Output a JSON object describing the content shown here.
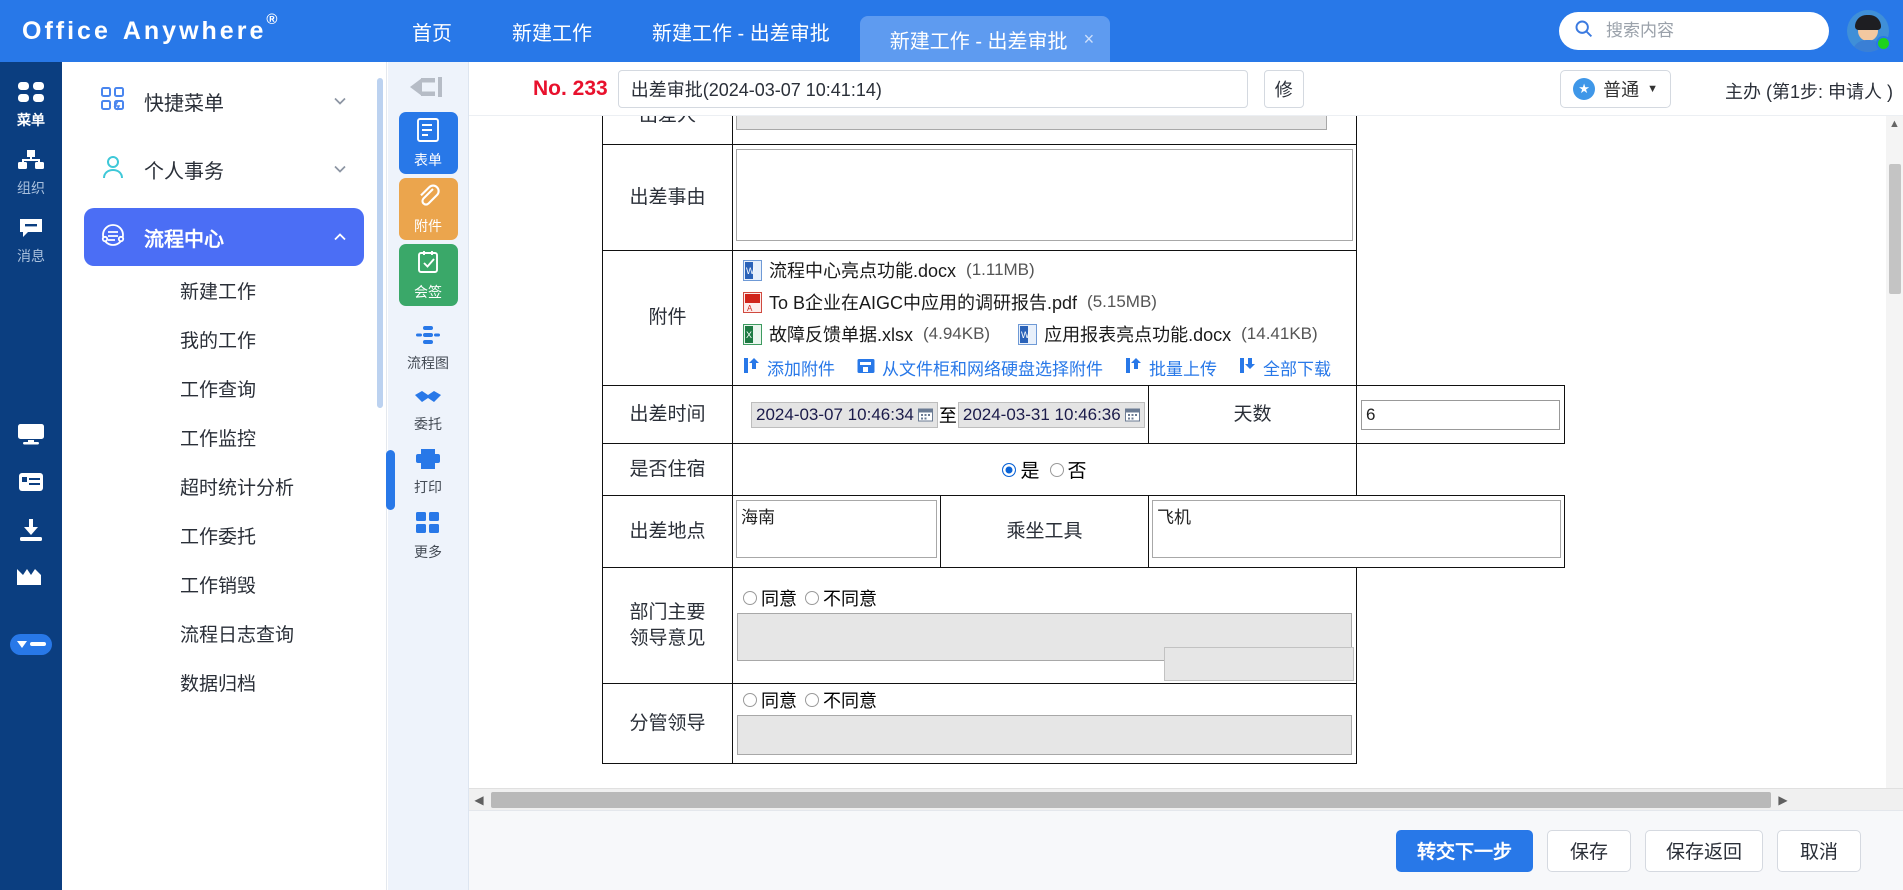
{
  "brand": {
    "name_part1": "Office",
    "name_part2": "Anywhere",
    "registered": "®"
  },
  "header": {
    "tabs": [
      {
        "label": "首页",
        "active": false,
        "closable": false
      },
      {
        "label": "新建工作",
        "active": false,
        "closable": false
      },
      {
        "label": "新建工作 - 出差审批",
        "active": false,
        "closable": false
      },
      {
        "label": "新建工作 - 出差审批",
        "active": true,
        "closable": true,
        "close_icon": "close-icon"
      }
    ],
    "search": {
      "placeholder": "搜索内容",
      "value": "",
      "icon": "search-icon"
    },
    "avatar": {
      "icon": "avatar",
      "status": "online"
    }
  },
  "rail": {
    "items": [
      {
        "label": "菜单",
        "icon": "grid-icon",
        "active": true
      },
      {
        "label": "组织",
        "icon": "org-tree-icon",
        "active": false
      },
      {
        "label": "消息",
        "icon": "message-icon",
        "active": false
      }
    ],
    "bottom_icons": [
      "monitor-icon",
      "card-icon",
      "download-icon",
      "crown-icon",
      "collapse-pill-icon"
    ]
  },
  "sidebar": {
    "groups": [
      {
        "label": "快捷菜单",
        "icon": "quick-menu-icon",
        "expanded": false,
        "chevron": "chevron-down-icon",
        "selected": false
      },
      {
        "label": "个人事务",
        "icon": "person-icon",
        "expanded": false,
        "chevron": "chevron-down-icon",
        "selected": false
      },
      {
        "label": "流程中心",
        "icon": "process-icon",
        "expanded": true,
        "chevron": "chevron-up-icon",
        "selected": true
      }
    ],
    "sub_items": [
      "新建工作",
      "我的工作",
      "工作查询",
      "工作监控",
      "超时统计分析",
      "工作委托",
      "工作销毁",
      "流程日志查询",
      "数据归档"
    ]
  },
  "toolstrip": {
    "collapse_icon": "collapse-left-icon",
    "cards": [
      {
        "label": "表单",
        "icon": "form-icon",
        "color": "#2878e8"
      },
      {
        "label": "附件",
        "icon": "paperclip-icon",
        "color": "#eba54d"
      },
      {
        "label": "会签",
        "icon": "checklist-icon",
        "color": "#3aa869"
      }
    ],
    "plain": [
      {
        "label": "流程图",
        "icon": "flowchart-icon"
      },
      {
        "label": "委托",
        "icon": "handshake-icon"
      },
      {
        "label": "打印",
        "icon": "printer-icon"
      },
      {
        "label": "更多",
        "icon": "more-grid-icon"
      }
    ]
  },
  "form_header": {
    "no_label": "No. 233",
    "title_value": "出差审批(2024-03-07 10:41:14)",
    "title_placeholder": "",
    "fix_button": "修",
    "priority": {
      "label": "普通",
      "icon": "star-badge-icon",
      "caret": "caret-down-icon"
    },
    "step_info": "主办 (第1步: 申请人 )"
  },
  "form": {
    "rows": {
      "traveler": {
        "label": "出差人",
        "value": "",
        "person_icon": "person-picker-icon"
      },
      "reason": {
        "label": "出差事由",
        "value": ""
      },
      "attachment": {
        "label": "附件",
        "files": [
          {
            "name": "流程中心亮点功能.docx",
            "size": "(1.11MB)",
            "icon": "word-file-icon"
          },
          {
            "name": "To B企业在AIGC中应用的调研报告.pdf",
            "size": "(5.15MB)",
            "icon": "pdf-file-icon"
          },
          {
            "name": "故障反馈单据.xlsx",
            "size": "(4.94KB)",
            "icon": "excel-file-icon"
          },
          {
            "name": "应用报表亮点功能.docx",
            "size": "(14.41KB)",
            "icon": "word-file-icon"
          }
        ],
        "actions": [
          {
            "label": "添加附件",
            "icon": "upload-icon"
          },
          {
            "label": "从文件柜和网络硬盘选择附件",
            "icon": "cabinet-icon"
          },
          {
            "label": "批量上传",
            "icon": "upload-icon"
          },
          {
            "label": "全部下载",
            "icon": "download-all-icon"
          }
        ]
      },
      "trip_time": {
        "label": "出差时间",
        "start": "2024-03-07 10:46:34",
        "separator": "至",
        "end": "2024-03-31 10:46:36",
        "calendar_icon": "calendar-icon",
        "days_label": "天数",
        "days_value": "6"
      },
      "lodging": {
        "label": "是否住宿",
        "options": [
          {
            "label": "是",
            "checked": true
          },
          {
            "label": "否",
            "checked": false
          }
        ]
      },
      "place": {
        "label": "出差地点",
        "value": "海南",
        "transport_label": "乘坐工具",
        "transport_value": "飞机"
      },
      "dept_opinion": {
        "label_line1": "部门主要",
        "label_line2": "领导意见",
        "options": [
          {
            "label": "同意",
            "checked": false
          },
          {
            "label": "不同意",
            "checked": false
          }
        ],
        "text": ""
      },
      "branch_opinion": {
        "label": "分管领导",
        "options": [
          {
            "label": "同意",
            "checked": false
          },
          {
            "label": "不同意",
            "checked": false
          }
        ],
        "text": ""
      }
    }
  },
  "footer": {
    "buttons": [
      {
        "label": "转交下一步",
        "primary": true
      },
      {
        "label": "保存",
        "primary": false
      },
      {
        "label": "保存返回",
        "primary": false
      },
      {
        "label": "取消",
        "primary": false
      }
    ]
  },
  "scroll": {
    "h_left_arrow": "◀",
    "h_right_arrow": "▶",
    "v_up": "▲",
    "v_down": "▼"
  },
  "colors": {
    "brand_blue": "#2878e8",
    "rail_blue": "#0b3e80",
    "sel_violet": "#4b6ef5",
    "danger_red": "#e8112d"
  }
}
